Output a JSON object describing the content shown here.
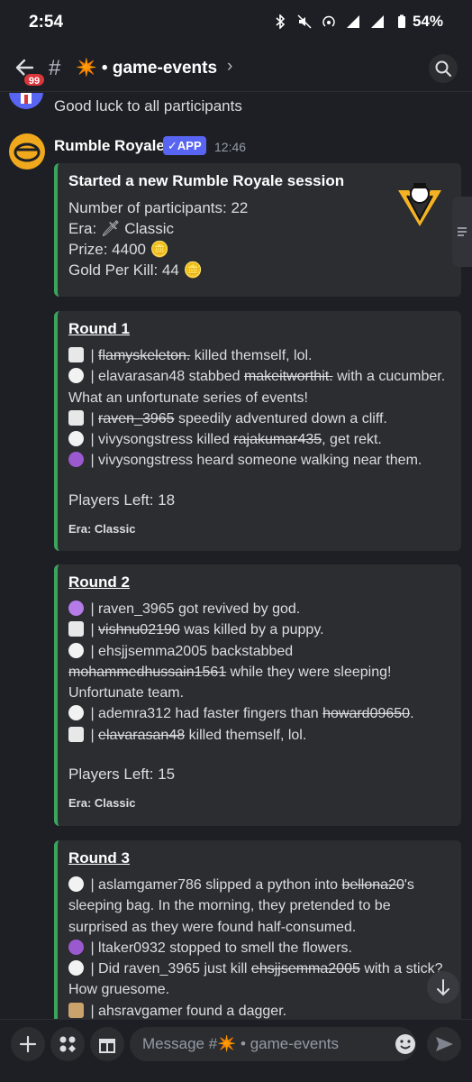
{
  "status_bar": {
    "time": "2:54",
    "battery": "54%"
  },
  "header": {
    "unread_count": "99",
    "channel_name": "✴️ • game-events",
    "chevron": "›"
  },
  "previous_message": {
    "text": "Good luck to all participants"
  },
  "message": {
    "author": "Rumble Royale",
    "badge": "✓APP",
    "timestamp": "12:46"
  },
  "session_embed": {
    "title": "Started a new Rumble Royale session",
    "participants": "Number of participants: 22",
    "era": "Era: 🗡 Classic",
    "prize": "Prize: 4400 🪙",
    "gold_per_kill": "Gold Per Kill: 44 🪙"
  },
  "rounds": [
    {
      "title": "Round 1",
      "events": [
        {
          "icon": "tombstone",
          "pre": " | ",
          "victim": "flamyskeleton.",
          "post": " killed themself, lol."
        },
        {
          "icon": "skull",
          "pre": " | elavarasan48 stabbed ",
          "victim": "makeitworthit.",
          "post": " with a cucumber. What an unfortunate series of events!"
        },
        {
          "icon": "tombstone",
          "pre": " | ",
          "victim": "raven_3965",
          "post": " speedily adventured down a cliff."
        },
        {
          "icon": "skull",
          "pre": " | vivysongstress killed ",
          "victim": "rajakumar435",
          "post": ", get rekt."
        },
        {
          "icon": "egg",
          "pre": " | vivysongstress heard someone walking near them.",
          "victim": "",
          "post": ""
        }
      ],
      "players_left": "Players Left: 18",
      "era": "Era: Classic"
    },
    {
      "title": "Round 2",
      "events": [
        {
          "icon": "revive",
          "pre": " | raven_3965 got revived by god.",
          "victim": "",
          "post": ""
        },
        {
          "icon": "tombstone",
          "pre": " | ",
          "victim": "vishnu02190",
          "post": " was killed by a puppy."
        },
        {
          "icon": "skull",
          "pre": " | ehsjjsemma2005 backstabbed ",
          "victim": "mohammedhussain1561",
          "post": " while they were sleeping! Unfortunate team."
        },
        {
          "icon": "skull",
          "pre": " | ademra312 had faster fingers than ",
          "victim": "howard09650",
          "post": "."
        },
        {
          "icon": "tombstone",
          "pre": " | ",
          "victim": "elavarasan48",
          "post": " killed themself, lol."
        }
      ],
      "players_left": "Players Left: 15",
      "era": "Era: Classic"
    },
    {
      "title": "Round 3",
      "events": [
        {
          "icon": "skull",
          "pre": " | aslamgamer786 slipped a python into ",
          "victim": "bellona20",
          "post": "'s sleeping bag. In the morning, they pretended to be surprised as they were found half-consumed."
        },
        {
          "icon": "egg",
          "pre": " | ltaker0932 stopped to smell the flowers.",
          "victim": "",
          "post": ""
        },
        {
          "icon": "skull",
          "pre": " | Did raven_3965 just kill ",
          "victim": "ehsjjsemma2005",
          "post": " with a stick? How gruesome."
        },
        {
          "icon": "dagger",
          "pre": " | ahsravgamer found a dagger.",
          "victim": "",
          "post": ""
        }
      ]
    }
  ],
  "input_bar": {
    "placeholder": "Message #✴️ • game-events"
  },
  "colors": {
    "accent": "#5865f2",
    "embed_border": "#3ba55d",
    "badge_red": "#da373c",
    "background": "#1e1f24",
    "embed_bg": "#2b2d31"
  }
}
